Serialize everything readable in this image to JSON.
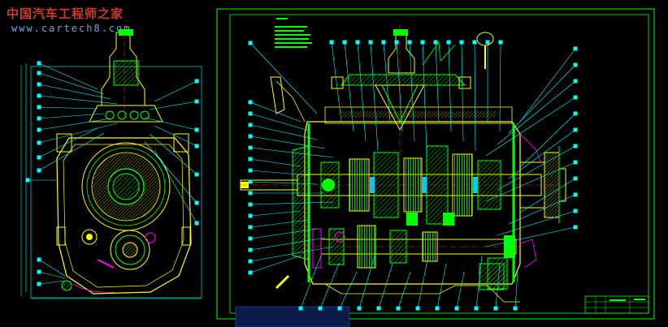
{
  "watermark": {
    "site_name": "中国汽车工程师之家",
    "url": "www.cartech8.com"
  },
  "colors": {
    "background": "#000000",
    "outline": "#ffff00",
    "part": "#00ff00",
    "leader": "#00ffff",
    "frame": "#00ff00",
    "hatch": "#00ff00",
    "section": "#ff00ff",
    "center_line": "#ff3030",
    "tag": "#00ffff"
  }
}
